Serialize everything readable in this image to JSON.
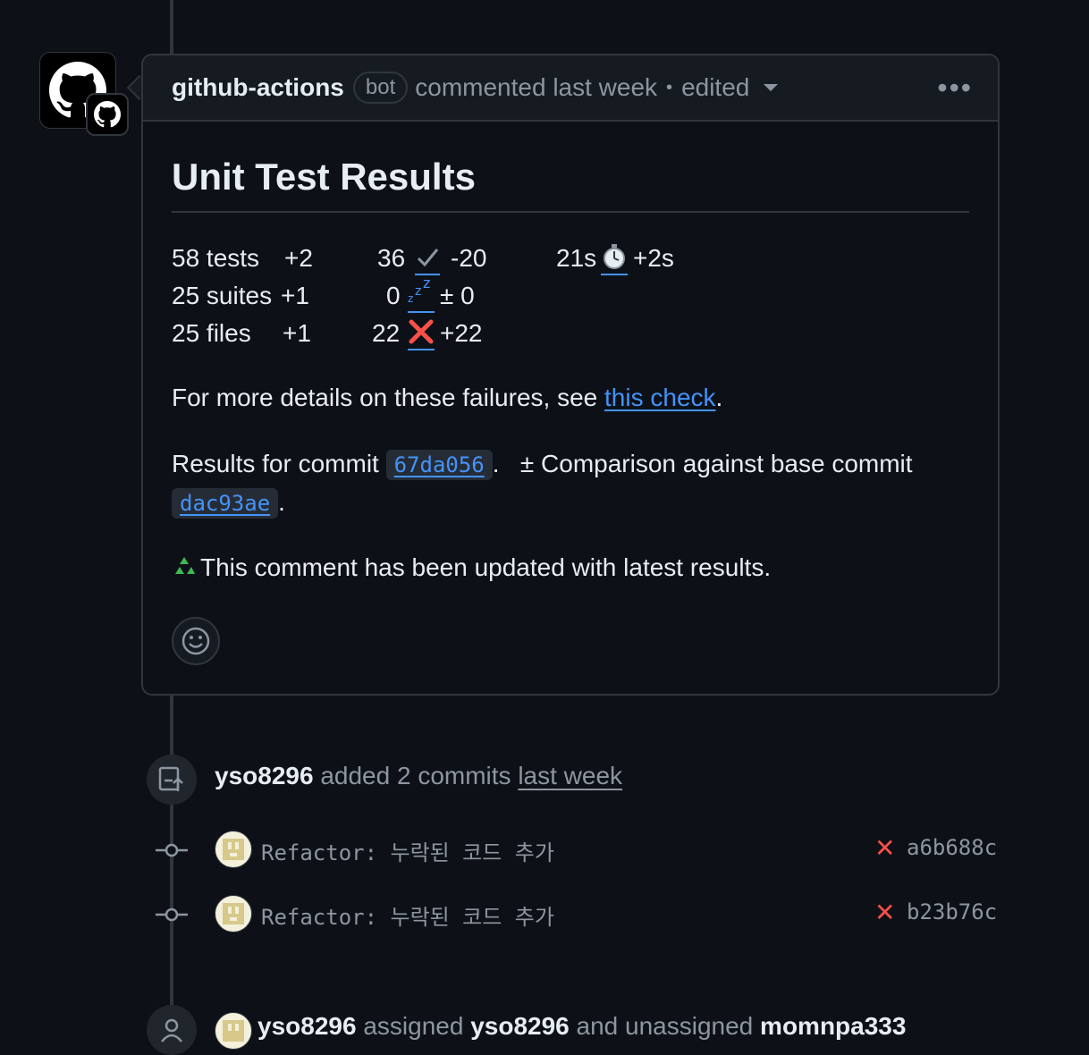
{
  "comment": {
    "author": "github-actions",
    "badge": "bot",
    "meta": "commented last week",
    "separator": "•",
    "edited": "edited",
    "title": "Unit Test Results",
    "stats": {
      "tests": "58 tests",
      "tests_delta": "+2",
      "suites": "25 suites",
      "suites_delta": "+1",
      "files": "25 files",
      "files_delta": "+1",
      "passed": "36",
      "passed_delta": "-20",
      "skipped": "0",
      "skipped_delta": "± 0",
      "failed": "22",
      "failed_delta": "+22",
      "duration": "21s",
      "duration_delta": "+2s"
    },
    "details_prefix": "For more details on these failures, see ",
    "details_link": "this check",
    "details_suffix": ".",
    "results_prefix": "Results for commit ",
    "results_commit": "67da056",
    "results_mid": ".   ± Comparison against base commit",
    "base_commit": "dac93ae",
    "results_suffix": ".",
    "updated_note": "This comment has been updated with latest results."
  },
  "events": {
    "commits_event": {
      "user": "yso8296",
      "action": "added 2 commits",
      "time": "last week"
    },
    "commits": [
      {
        "message": "Refactor: 누락된 코드 추가",
        "sha": "a6b688c",
        "status": "✕"
      },
      {
        "message": "Refactor: 누락된 코드 추가",
        "sha": "b23b76c",
        "status": "✕"
      }
    ],
    "assign_event": {
      "user": "yso8296",
      "action1": "assigned",
      "target1": "yso8296",
      "action2": "and unassigned",
      "target2": "momnpa333"
    }
  },
  "colors": {
    "background": "#0d1117",
    "border": "#30363d",
    "link": "#4493f8",
    "danger": "#f85149",
    "muted": "#8d96a0"
  },
  "icons": [
    "github-logo-icon",
    "kebab-icon",
    "check-icon",
    "zzz-icon",
    "cross-icon",
    "stopwatch-icon",
    "recycle-icon",
    "smiley-icon",
    "push-icon",
    "commit-node-icon",
    "person-icon"
  ]
}
